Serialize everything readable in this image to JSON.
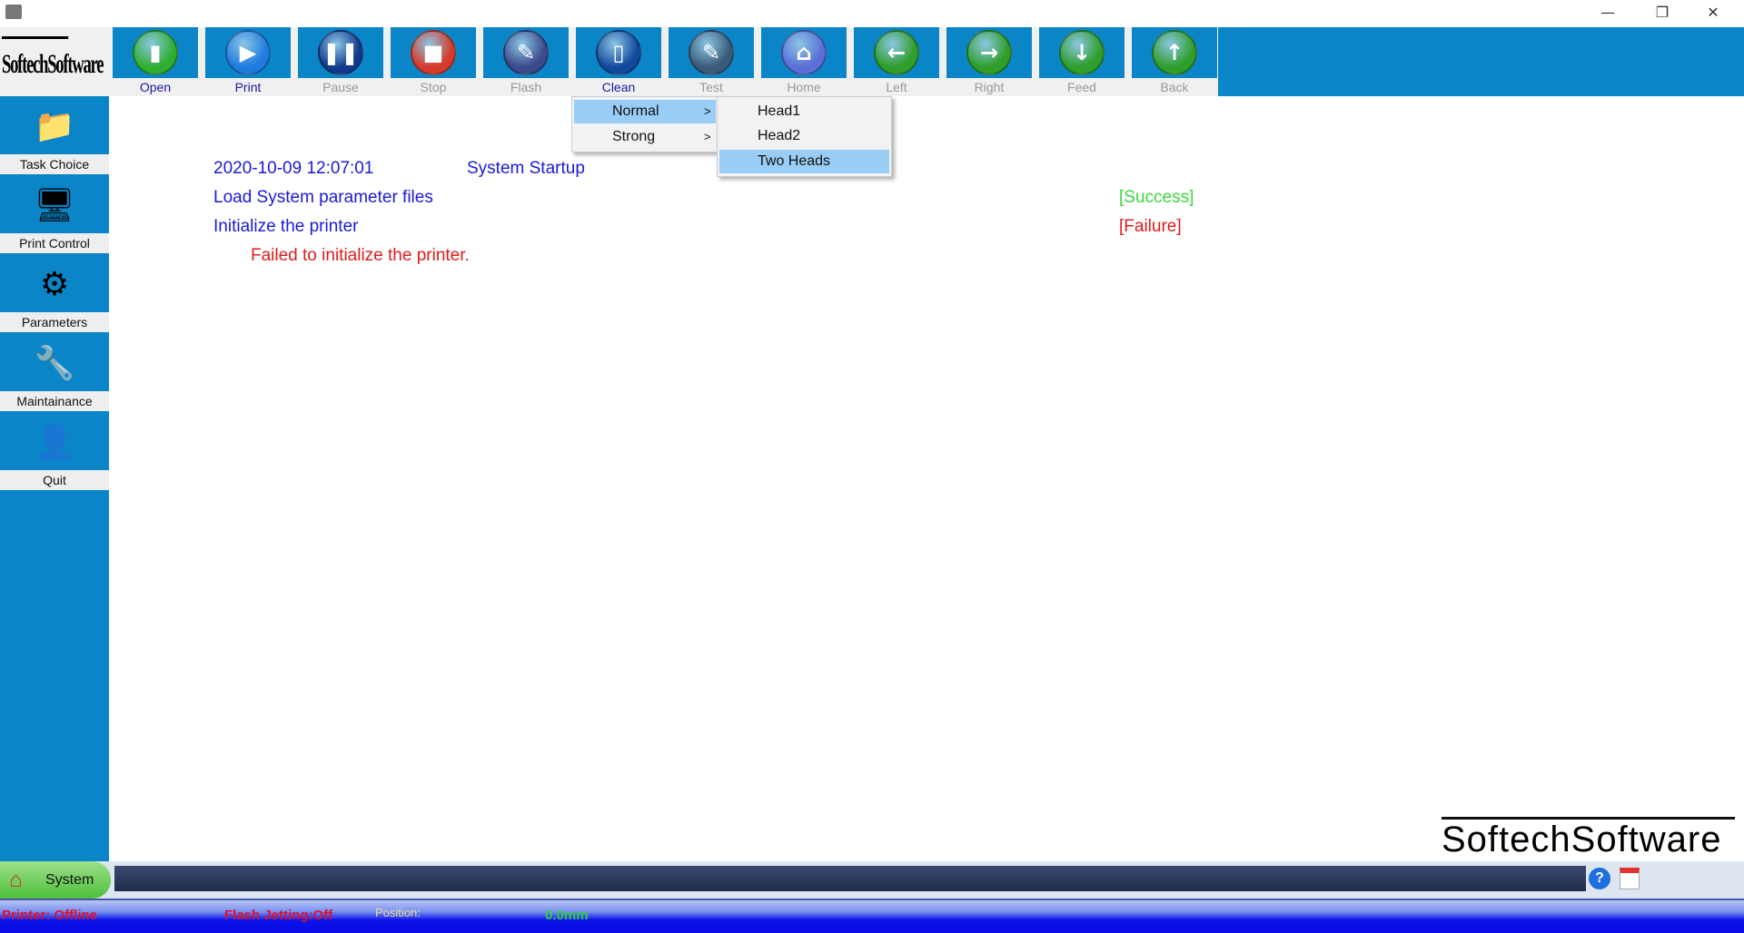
{
  "window": {
    "minimize": "—",
    "restore": "❐",
    "close": "✕"
  },
  "logo_text": "SoftechSoftware",
  "toolbar": [
    {
      "label": "Open",
      "enabled": true,
      "color": "#2fae2f",
      "glyph": "▮"
    },
    {
      "label": "Print",
      "enabled": true,
      "color": "#1f7be0",
      "glyph": "▶"
    },
    {
      "label": "Pause",
      "enabled": false,
      "color": "#123a8c",
      "glyph": "❚❚"
    },
    {
      "label": "Stop",
      "enabled": false,
      "color": "#d63a2a",
      "glyph": "■"
    },
    {
      "label": "Flash",
      "enabled": false,
      "color": "#3a4a8c",
      "glyph": "✎"
    },
    {
      "label": "Clean",
      "enabled": true,
      "color": "#134a9c",
      "glyph": "▯"
    },
    {
      "label": "Test",
      "enabled": false,
      "color": "#3b5a7a",
      "glyph": "✎"
    },
    {
      "label": "Home",
      "enabled": false,
      "color": "#5a6fd8",
      "glyph": "⌂"
    },
    {
      "label": "Left",
      "enabled": false,
      "color": "#2f9e2a",
      "glyph": "←"
    },
    {
      "label": "Right",
      "enabled": false,
      "color": "#2f9e2a",
      "glyph": "→"
    },
    {
      "label": "Feed",
      "enabled": false,
      "color": "#2f9e2a",
      "glyph": "↓"
    },
    {
      "label": "Back",
      "enabled": false,
      "color": "#2f9e2a",
      "glyph": "↑"
    }
  ],
  "sidebar": [
    {
      "label": "Task Choice",
      "glyph": "📁"
    },
    {
      "label": "Print Control",
      "glyph": "🖥"
    },
    {
      "label": "Parameters",
      "glyph": "⚙"
    },
    {
      "label": "Maintainance",
      "glyph": "🔧"
    },
    {
      "label": "Quit",
      "glyph": "👤"
    }
  ],
  "log": {
    "timestamp": "2020-10-09 12:07:01",
    "startup": "System Startup",
    "load": "Load System parameter files",
    "load_status": "[Success]",
    "init": "Initialize the printer",
    "init_status": "[Failure]",
    "error": "Failed to initialize the printer."
  },
  "clean_menu": {
    "items": [
      "Normal",
      "Strong"
    ],
    "arrow": ">",
    "submenu": [
      "Head1",
      "Head2",
      "Two Heads"
    ]
  },
  "brand_footer": "SoftechSoftware",
  "bottom": {
    "system_tab": "System"
  },
  "status": {
    "printer": "Printer: Offline",
    "flash": "Flash Jetting:Off",
    "position_label": "Position:",
    "position_value": "0.0mm"
  }
}
